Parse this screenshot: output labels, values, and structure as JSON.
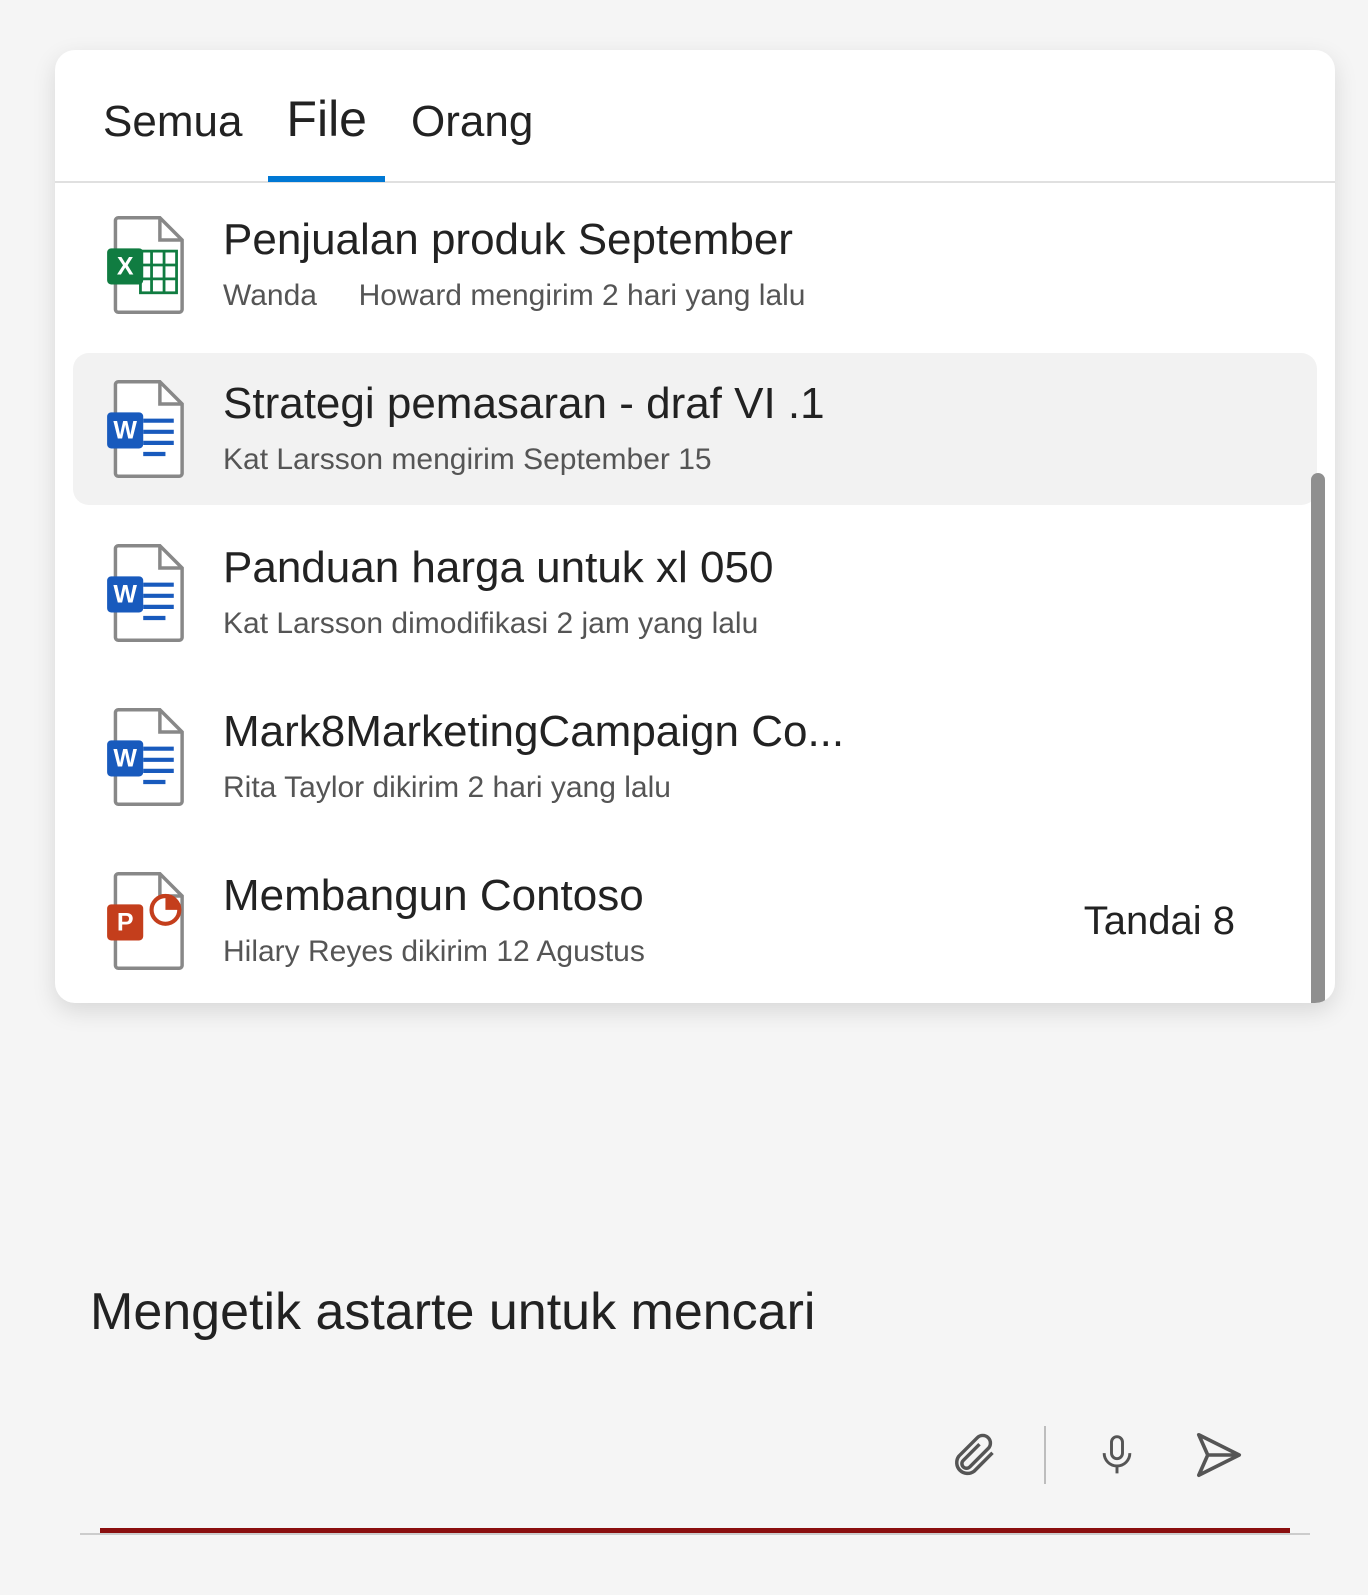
{
  "tabs": {
    "all": "Semua",
    "files": "File",
    "people": "Orang",
    "active": "files"
  },
  "results": [
    {
      "type": "excel",
      "title": "Penjualan produk September",
      "sub": "Wanda     Howard mengirim 2 hari yang lalu",
      "selected": false,
      "badge": ""
    },
    {
      "type": "word",
      "title": "Strategi pemasaran - draf VI .1",
      "sub": "Kat Larsson mengirim September 15",
      "selected": true,
      "badge": ""
    },
    {
      "type": "word",
      "title": "Panduan harga untuk xl 050",
      "sub": "Kat Larsson dimodifikasi 2 jam yang lalu",
      "selected": false,
      "badge": ""
    },
    {
      "type": "word",
      "title": "Mark8MarketingCampaign Co...",
      "sub": "Rita Taylor dikirim 2 hari yang lalu",
      "selected": false,
      "badge": ""
    },
    {
      "type": "powerpoint",
      "title": "Membangun Contoso",
      "sub": "Hilary Reyes dikirim 12 Agustus",
      "selected": false,
      "badge": "Tandai 8"
    }
  ],
  "input": {
    "text": "Mengetik astarte untuk mencari"
  },
  "icons": {
    "attach": "attach-icon",
    "mic": "mic-icon",
    "send": "send-icon"
  }
}
